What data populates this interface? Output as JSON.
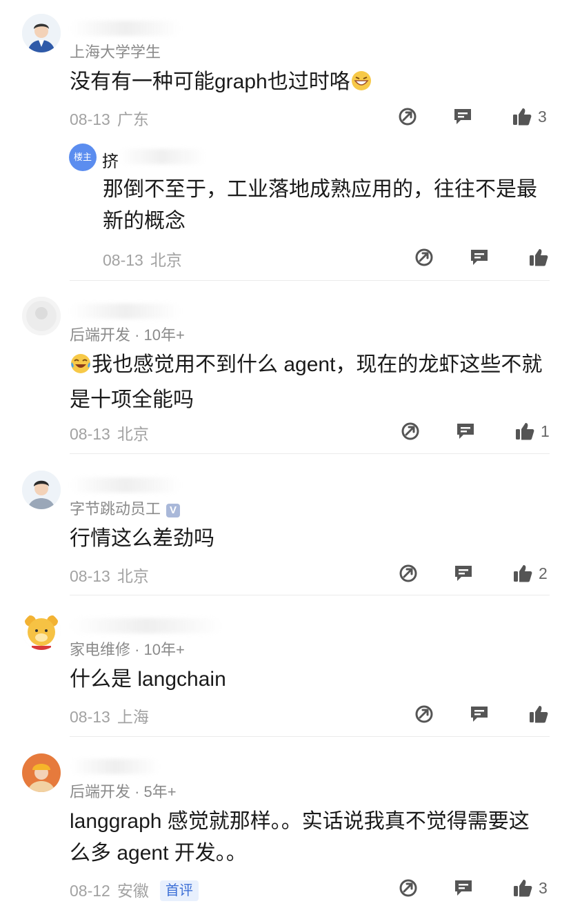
{
  "comments": [
    {
      "author_tag": "上海大学学生",
      "text": "没有有一种可能graph也过时咯",
      "emoji": "grin-emoji",
      "date": "08-13",
      "location": "广东",
      "likes": "3",
      "reply": {
        "badge": "楼主",
        "initial": "挤",
        "text": "那倒不至于，工业落地成熟应用的，往往不是最新的概念",
        "date": "08-13",
        "location": "北京"
      }
    },
    {
      "author_tag": "后端开发 · 10年+",
      "text": "我也感觉用不到什么 agent，现在的龙虾这些不就是十项全能吗",
      "emoji": "laugh-cry-emoji",
      "date": "08-13",
      "location": "北京",
      "likes": "1"
    },
    {
      "author_tag": "字节跳动员工",
      "verified": "V",
      "text": "行情这么差劲吗",
      "date": "08-13",
      "location": "北京",
      "likes": "2"
    },
    {
      "author_tag": "家电维修 · 10年+",
      "text": "什么是 langchain",
      "date": "08-13",
      "location": "上海",
      "likes": ""
    },
    {
      "author_tag": "后端开发 · 5年+",
      "text": "langgraph 感觉就那样。。实话说我真不觉得需要这么多 agent 开发。。",
      "date": "08-12",
      "location": "安徽",
      "first_badge": "首评",
      "likes": "3"
    }
  ],
  "icons": {
    "share": "share-icon",
    "reply": "comment-icon",
    "like": "thumbs-up-icon"
  },
  "colors": {
    "meta": "#a2a2a2",
    "author_tag": "#8a8a8a",
    "reply_badge": "#5b8def",
    "first_badge_bg": "#e8f0fd",
    "first_badge_text": "#3c6fd6"
  }
}
